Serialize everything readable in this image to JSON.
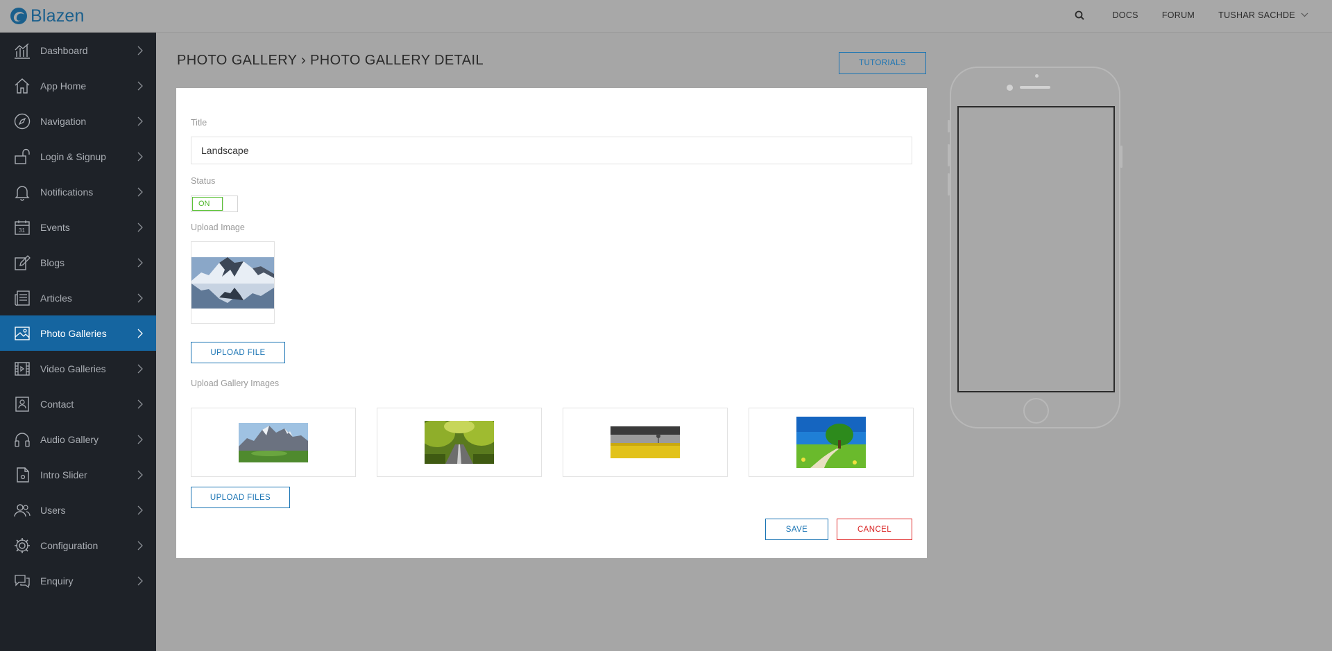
{
  "app": {
    "name": "Blazen"
  },
  "topnav": {
    "docs": "DOCS",
    "forum": "FORUM",
    "user": "TUSHAR SACHDE"
  },
  "sidebar": {
    "items": [
      {
        "label": "Dashboard",
        "icon": "bar-chart-icon",
        "active": false
      },
      {
        "label": "App Home",
        "icon": "home-icon",
        "active": false
      },
      {
        "label": "Navigation",
        "icon": "compass-icon",
        "active": false
      },
      {
        "label": "Login & Signup",
        "icon": "unlock-icon",
        "active": false
      },
      {
        "label": "Notifications",
        "icon": "bell-icon",
        "active": false
      },
      {
        "label": "Events",
        "icon": "calendar-icon",
        "active": false
      },
      {
        "label": "Blogs",
        "icon": "edit-icon",
        "active": false
      },
      {
        "label": "Articles",
        "icon": "newspaper-icon",
        "active": false
      },
      {
        "label": "Photo Galleries",
        "icon": "image-icon",
        "active": true
      },
      {
        "label": "Video Galleries",
        "icon": "film-icon",
        "active": false
      },
      {
        "label": "Contact",
        "icon": "contact-card-icon",
        "active": false
      },
      {
        "label": "Audio Gallery",
        "icon": "headphones-icon",
        "active": false
      },
      {
        "label": "Intro Slider",
        "icon": "slider-icon",
        "active": false
      },
      {
        "label": "Users",
        "icon": "users-icon",
        "active": false
      },
      {
        "label": "Configuration",
        "icon": "gear-icon",
        "active": false
      },
      {
        "label": "Enquiry",
        "icon": "chat-bubbles-icon",
        "active": false
      }
    ]
  },
  "page": {
    "title": "PHOTO GALLERY › PHOTO GALLERY DETAIL",
    "tutorials": "TUTORIALS"
  },
  "form": {
    "title_label": "Title",
    "title_value": "Landscape",
    "status_label": "Status",
    "status_value": "ON",
    "upload_image_label": "Upload Image",
    "upload_file": "UPLOAD FILE",
    "gallery_label": "Upload Gallery Images",
    "upload_files": "UPLOAD FILES",
    "save": "SAVE",
    "cancel": "CANCEL"
  },
  "colors": {
    "accent": "#1a74b4",
    "sidebar_bg": "#1e2228",
    "active_bg": "#1565a0",
    "toggle_on": "#4cb628",
    "cancel": "#d92525"
  }
}
